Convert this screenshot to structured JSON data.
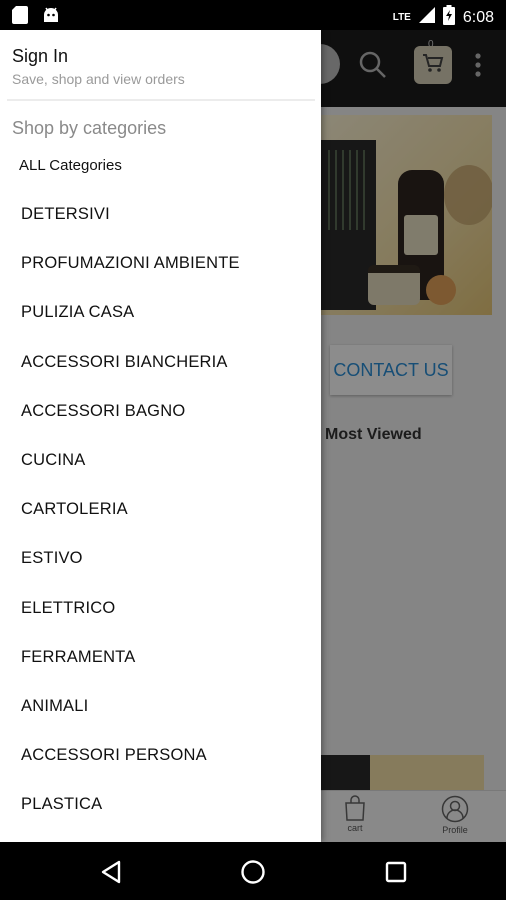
{
  "status_bar": {
    "network": "LTE",
    "time": "6:08",
    "icons": [
      "sd-card-icon",
      "android-icon",
      "signal-icon",
      "battery-icon"
    ]
  },
  "app_toolbar": {
    "cart_count": "0",
    "icons": [
      "search-icon",
      "cart-icon",
      "more-vert-icon"
    ]
  },
  "app_content": {
    "contact_label": "CONTACT US",
    "most_viewed_label": "Most Viewed"
  },
  "app_bottom_nav": {
    "items": [
      {
        "label": "cart",
        "icon": "shopping-bag-icon"
      },
      {
        "label": "Profile",
        "icon": "profile-icon"
      }
    ]
  },
  "drawer": {
    "sign_in_title": "Sign In",
    "sign_in_subtitle": "Save, shop and view orders",
    "section_title": "Shop by categories",
    "all_categories_label": "ALL Categories",
    "categories": [
      "DETERSIVI",
      "PROFUMAZIONI AMBIENTE",
      "PULIZIA CASA",
      "ACCESSORI BIANCHERIA",
      "ACCESSORI BAGNO",
      "CUCINA",
      "CARTOLERIA",
      "ESTIVO",
      "ELETTRICO",
      "FERRAMENTA",
      "ANIMALI",
      "ACCESSORI PERSONA",
      "PLASTICA"
    ]
  },
  "system_nav": {
    "icons": [
      "back-icon",
      "home-icon",
      "recents-icon"
    ]
  },
  "colors": {
    "status_bar_bg": "#000000",
    "toolbar_bg": "#1d1d1d",
    "drawer_bg": "#ffffff",
    "contact_text": "#2a8fd8"
  }
}
